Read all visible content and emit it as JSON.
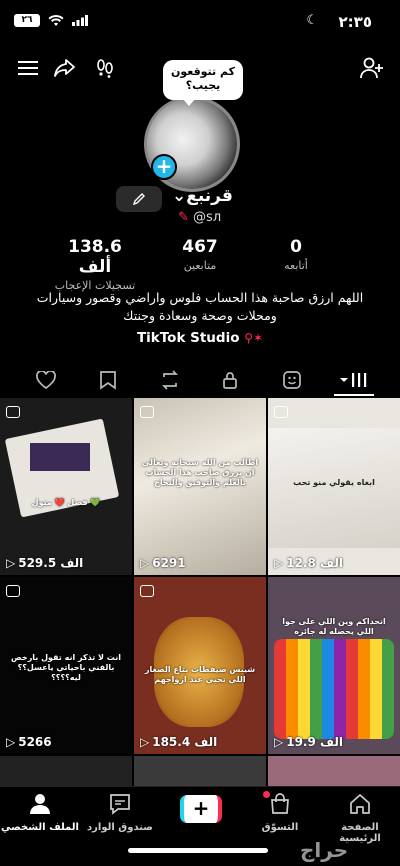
{
  "status": {
    "time": "٢:٣٥",
    "battery": "٢٦"
  },
  "profile": {
    "bubble": "كم تتوقعون يجيب؟",
    "name": "قرنبع",
    "handle": "@sл",
    "stats": [
      {
        "value": "0",
        "label": "أتابعه"
      },
      {
        "value": "467",
        "label": "متابعين"
      },
      {
        "value": "138.6 ألف",
        "label": "تسجيلات الإعجاب"
      }
    ],
    "bio": "اللهم ارزق صاحبة هذا الحساب فلوس واراضي وقصور وسيارات ومحلات وصحة وسعادة وجنتك",
    "studio": "TikTok Studio"
  },
  "videos": [
    {
      "views": "529.5 الف",
      "caption": "فصل ❤️ متول 💚",
      "bg": "#1a1a1a"
    },
    {
      "views": "6291",
      "caption": "اطالب من الله سبحانه وتعالى ان يرزق صاحب هذا الحساب بالعلم والتوفيق والنجاح",
      "bg": "#d8d2c4"
    },
    {
      "views": "12.8 الف",
      "caption": "ابغاه يقولي منو تحب",
      "bg": "#e9e6e0"
    },
    {
      "views": "5266",
      "caption": "انت لا تذكر انه تقول بارخص بالفني باحياتي ياعسل؟؟ ليه؟؟؟؟",
      "bg": "#050505"
    },
    {
      "views": "185.4 الف",
      "caption": "شيبس صيفطات بتاع الصغار اللي تحيي عند ازواجهم",
      "bg": "#8a6a3a"
    },
    {
      "views": "19.9 الف",
      "caption": "اتحداكم وين اللي على جوا اللي يحصله له جائزه",
      "bg": "#3a2a4a"
    }
  ],
  "nav": [
    {
      "label": "الملف الشخصي"
    },
    {
      "label": "صندوق الوارد"
    },
    {
      "label": "التسوّق"
    },
    {
      "label": "الصفحة الرئيسية"
    }
  ],
  "watermark": "حراج"
}
